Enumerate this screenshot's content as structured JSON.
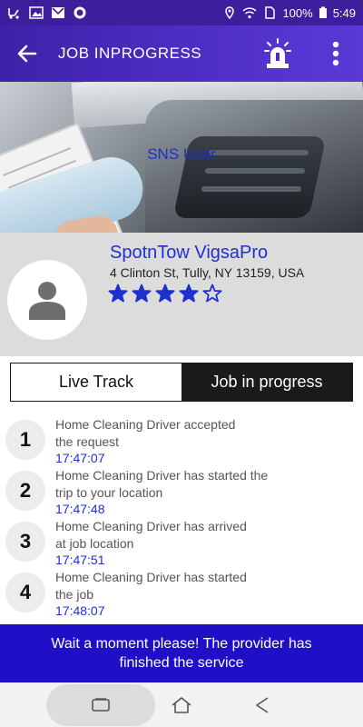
{
  "status_bar": {
    "battery": "100%",
    "time": "5:49",
    "left_icons": [
      "tow-truck-icon",
      "image-icon",
      "mail-icon",
      "circle-dot-icon"
    ],
    "right_icons": [
      "location-pin-icon",
      "wifi-icon",
      "sim-card-icon",
      "battery-icon"
    ]
  },
  "header": {
    "title": "JOB INPROGRESS",
    "icons": [
      "back-arrow-icon",
      "emergency-siren-icon",
      "more-vertical-icon"
    ]
  },
  "banner": {
    "caption": "SNS User"
  },
  "provider": {
    "name": "SpotnTow VigsaPro",
    "address": "4 Clinton St, Tully, NY 13159, USA",
    "rating": 4,
    "rating_max": 5,
    "avatar_icon": "person-silhouette-icon"
  },
  "tabs": [
    {
      "label": "Live Track",
      "active": false
    },
    {
      "label": "Job in progress",
      "active": true
    }
  ],
  "steps": [
    {
      "number": "1",
      "line1": "Home Cleaning Driver accepted",
      "line2": "the request",
      "time": "17:47:07"
    },
    {
      "number": "2",
      "line1": "Home Cleaning Driver has started the",
      "line2": "trip to your location",
      "time": "17:47:48"
    },
    {
      "number": "3",
      "line1": "Home Cleaning Driver has arrived",
      "line2": "at job location",
      "time": "17:47:51"
    },
    {
      "number": "4",
      "line1": "Home Cleaning Driver has started",
      "line2": "the job",
      "time": "17:48:07"
    }
  ],
  "notice": {
    "line1": "Wait a moment please! The provider has",
    "line2": "finished the service"
  },
  "nav_bar": {
    "icons": [
      "recent-apps-icon",
      "home-icon",
      "back-triangle-icon"
    ]
  },
  "colors": {
    "app_bar": "#4a2ec0",
    "accent_blue": "#1f2fd0",
    "notice_bg": "#1f10c8",
    "profile_bg": "#dcdcdc"
  }
}
